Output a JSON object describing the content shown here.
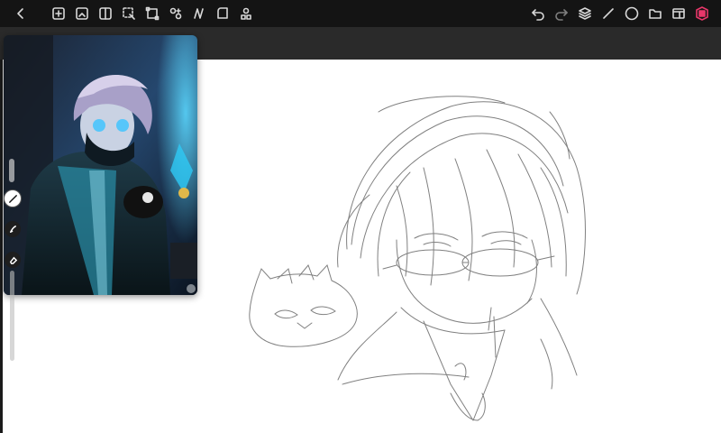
{
  "colors": {
    "toolbar_bg": "#141414",
    "icon": "#d8d8d8",
    "canvas_bg": "#ffffff",
    "accent_logo": "#e8376a"
  },
  "toolbar": {
    "left_icons": [
      "back-icon",
      "add-icon",
      "gallery-icon",
      "adjust-icon",
      "select-icon",
      "transform-icon",
      "symmetry-icon",
      "liquify-icon",
      "warp-icon",
      "layers-group-icon"
    ],
    "right_icons": [
      "undo-icon",
      "redo-icon",
      "layers-icon",
      "brush-icon",
      "color-icon",
      "folder-icon",
      "settings-icon",
      "app-logo-icon"
    ]
  },
  "reference": {
    "visible": true
  },
  "side_tools": [
    "brush-tool-icon",
    "smudge-tool-icon",
    "eraser-tool-icon"
  ]
}
